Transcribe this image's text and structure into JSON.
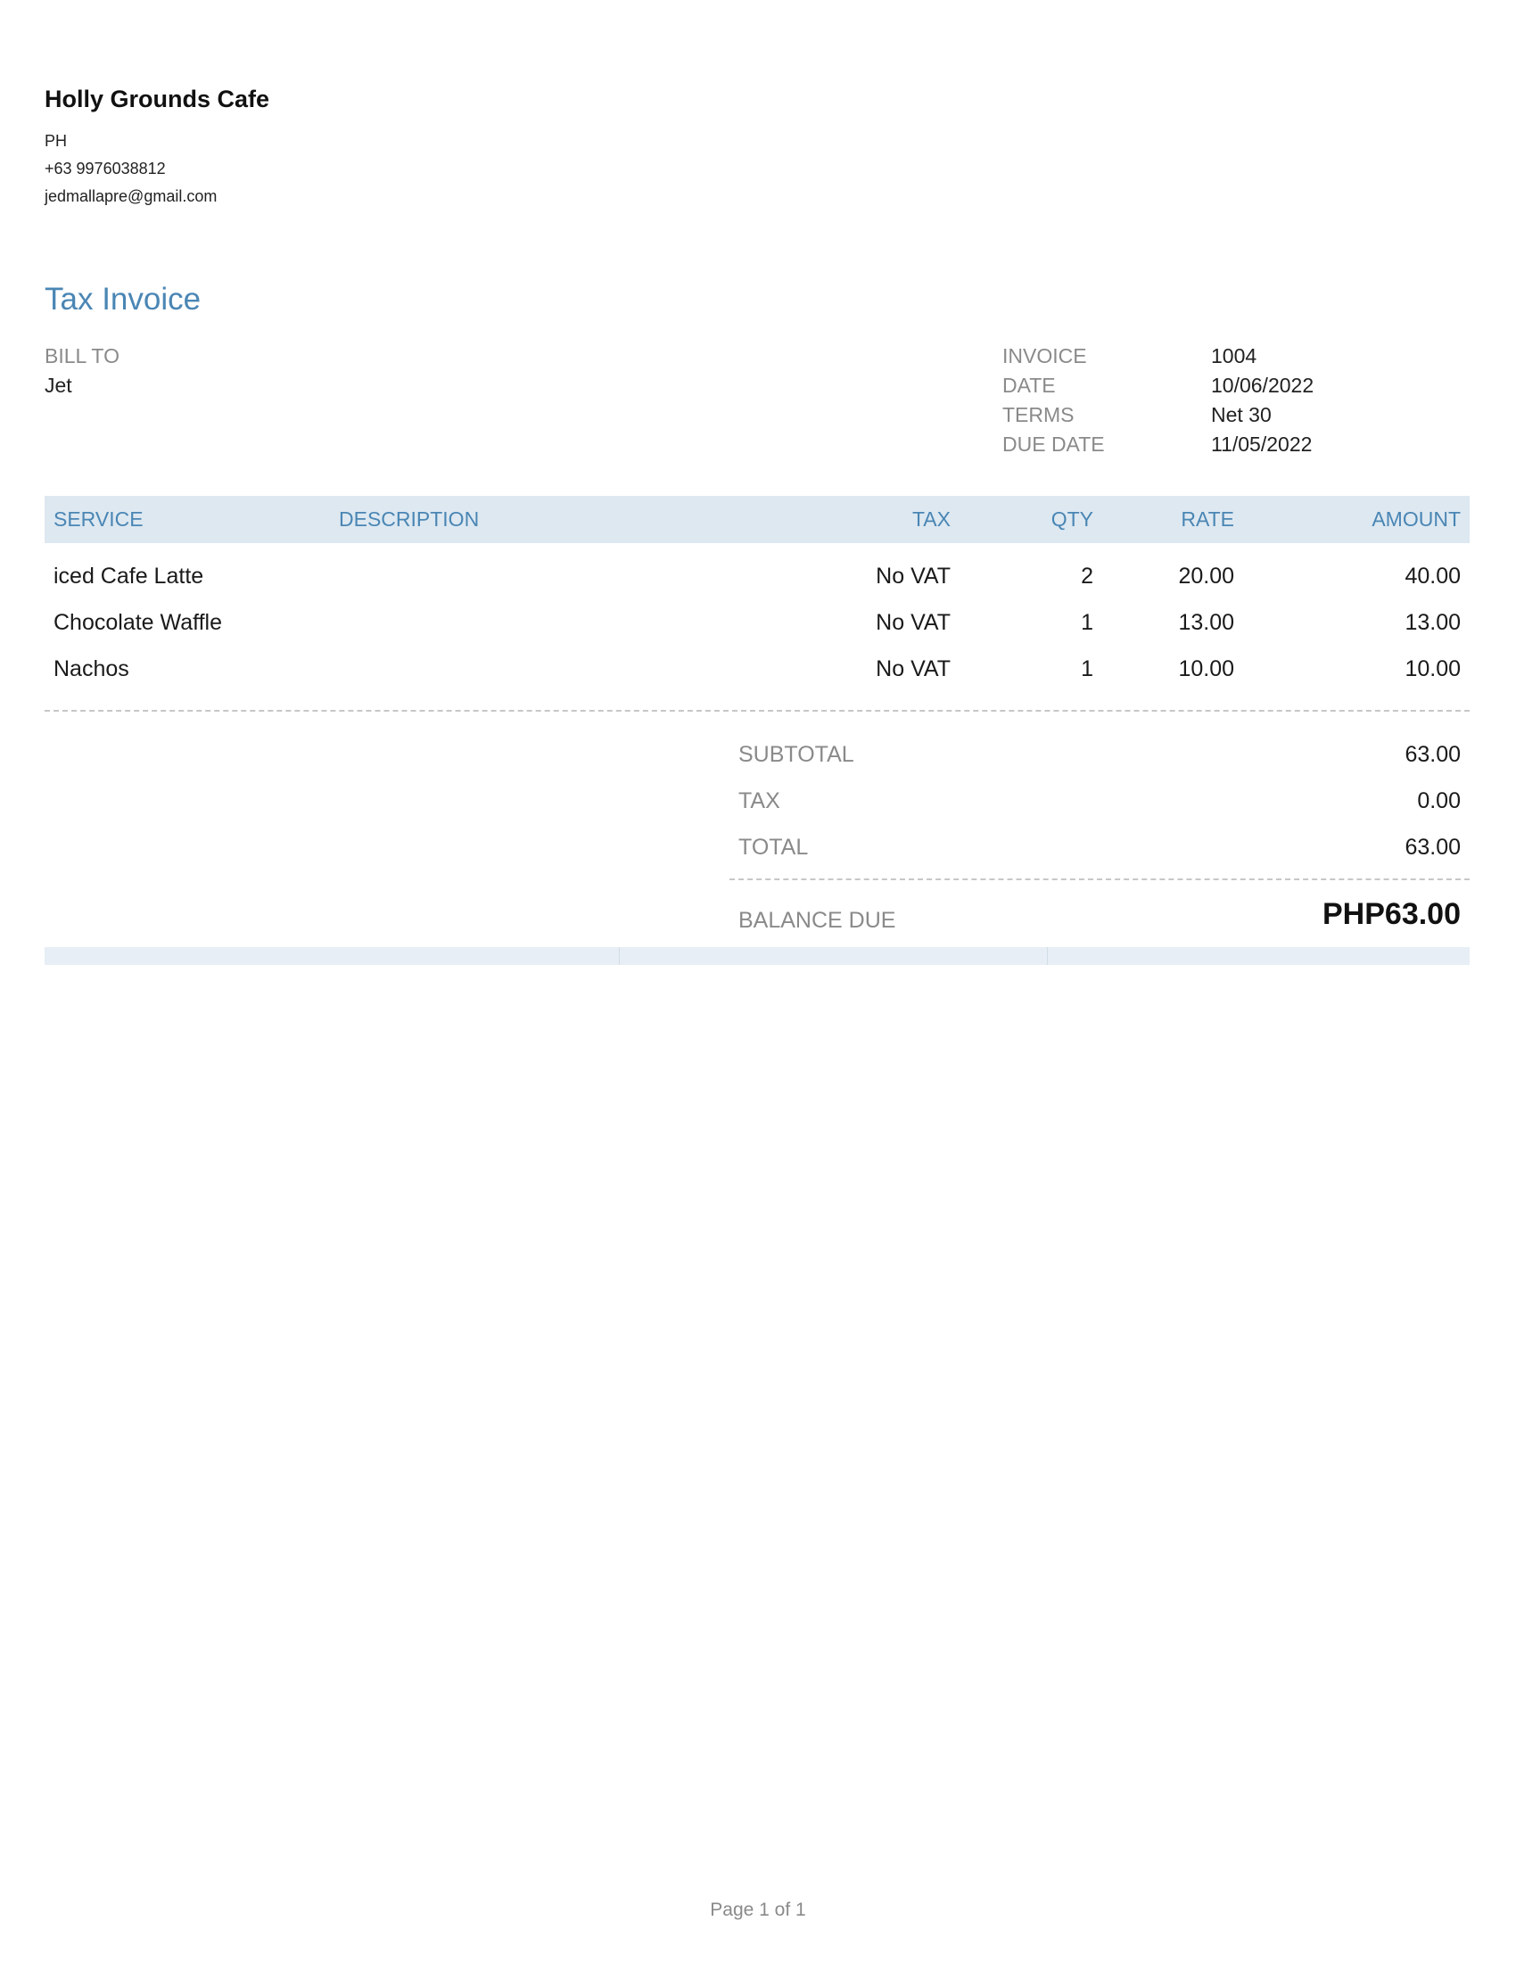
{
  "company": {
    "name": "Holly Grounds Cafe",
    "country": "PH",
    "phone": "+63 9976038812",
    "email": "jedmallapre@gmail.com"
  },
  "document": {
    "title": "Tax Invoice"
  },
  "bill_to": {
    "label": "BILL TO",
    "name": "Jet"
  },
  "meta": [
    {
      "label": "INVOICE",
      "value": "1004"
    },
    {
      "label": "DATE",
      "value": "10/06/2022"
    },
    {
      "label": "TERMS",
      "value": "Net 30"
    },
    {
      "label": "DUE DATE",
      "value": "11/05/2022"
    }
  ],
  "columns": {
    "service": "SERVICE",
    "description": "DESCRIPTION",
    "tax": "TAX",
    "qty": "QTY",
    "rate": "RATE",
    "amount": "AMOUNT"
  },
  "items": [
    {
      "service": "iced Cafe Latte",
      "description": "",
      "tax": "No VAT",
      "qty": "2",
      "rate": "20.00",
      "amount": "40.00"
    },
    {
      "service": "Chocolate Waffle",
      "description": "",
      "tax": "No VAT",
      "qty": "1",
      "rate": "13.00",
      "amount": "13.00"
    },
    {
      "service": "Nachos",
      "description": "",
      "tax": "No VAT",
      "qty": "1",
      "rate": "10.00",
      "amount": "10.00"
    }
  ],
  "totals": {
    "subtotal_label": "SUBTOTAL",
    "subtotal": "63.00",
    "tax_label": "TAX",
    "tax": "0.00",
    "total_label": "TOTAL",
    "total": "63.00",
    "balance_due_label": "BALANCE DUE",
    "balance_due": "PHP63.00"
  },
  "footer": {
    "page": "Page 1 of 1"
  },
  "colors": {
    "accent": "#4a86b4",
    "header_bg": "#dde8f1",
    "muted_text": "#8a8a8a"
  }
}
